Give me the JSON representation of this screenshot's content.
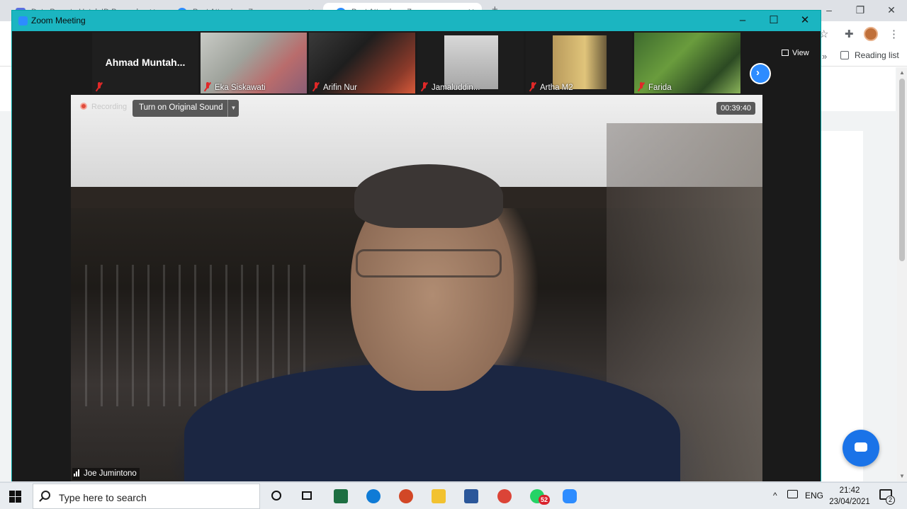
{
  "browser": {
    "tabs": [
      {
        "label": "Data Peserta Untuk ID Pengada..."
      },
      {
        "label": "Post Attendee - Zoom"
      },
      {
        "label": "Post Attendee - Zoom"
      }
    ],
    "reading_list": "Reading list"
  },
  "zoom": {
    "window_title": "Zoom Meeting",
    "view_label": "View",
    "participants": [
      {
        "name": "Ahmad  Muntah...",
        "muted": true
      },
      {
        "name": "Eka Siskawati",
        "muted": true
      },
      {
        "name": "Arifin Nur",
        "muted": true
      },
      {
        "name": "Jamaluddin...",
        "muted": true
      },
      {
        "name": "Artha M2",
        "muted": true
      },
      {
        "name": "Farida",
        "muted": true
      }
    ],
    "recording_label": "Recording",
    "original_sound_button": "Turn on Original Sound",
    "timer": "00:39:40",
    "active_speaker": "Joe Jumintono"
  },
  "taskbar": {
    "search_placeholder": "Type here to search",
    "apps": [
      {
        "name": "task-view"
      },
      {
        "name": "excel",
        "color": "#1d6f42"
      },
      {
        "name": "edge",
        "color": "#0f7bd6"
      },
      {
        "name": "powerpoint",
        "color": "#d24726"
      },
      {
        "name": "file-explorer",
        "color": "#f2c230"
      },
      {
        "name": "word",
        "color": "#2b579a"
      },
      {
        "name": "chrome",
        "color": "#db4437"
      },
      {
        "name": "whatsapp",
        "color": "#25d366",
        "badge": "52"
      },
      {
        "name": "zoom",
        "color": "#2d8cff"
      }
    ],
    "language": "ENG",
    "time": "21:42",
    "date": "23/04/2021",
    "notification_count": "2"
  }
}
